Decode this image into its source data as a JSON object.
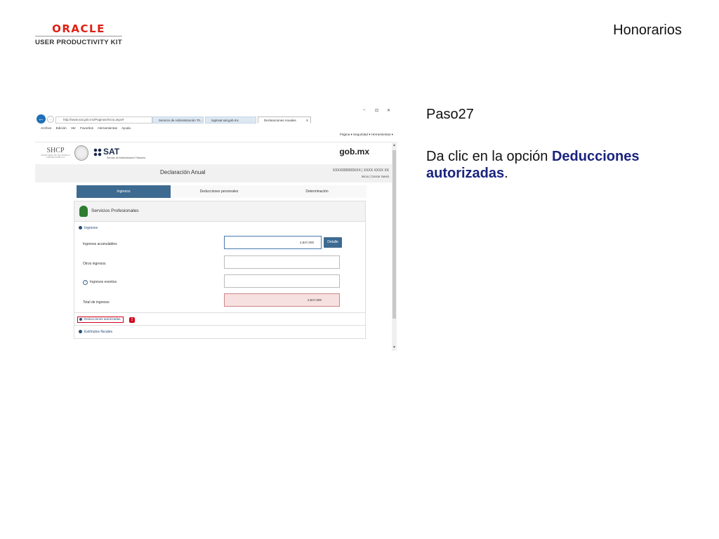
{
  "slide": {
    "logo_brand": "ORACLE",
    "logo_sub": "USER PRODUCTIVITY KIT",
    "title": "Honorarios",
    "step": "Paso27",
    "instruction_prefix": "Da clic en la opción ",
    "instruction_bold": "Deducciones autorizadas",
    "instruction_suffix": "."
  },
  "browser": {
    "address": "http://www.sat.gob.mx/Paginas/Inicio.aspx#",
    "tabs": [
      "Servicio de Administración Tri...",
      "loginsat.sat.gob.mx",
      "Declaraciones Anuales"
    ],
    "tab_close": "X",
    "window_controls": [
      "–",
      "⊡",
      "✕"
    ],
    "menu": [
      "Archivo",
      "Edición",
      "Ver",
      "Favoritos",
      "Herramientas",
      "Ayuda"
    ],
    "commandbar": "Página ▾   Seguridad ▾   Herramientas ▾"
  },
  "page": {
    "shcp": "SHCP",
    "shcp_sub": "SECRETARÍA DE HACIENDA Y CRÉDITO PÚBLICO",
    "sat": "SAT",
    "sat_sub": "Servicio de Administración Tributaria",
    "gob": "gob.mx",
    "decl_title": "Declaración Anual",
    "rfc": "XXXX000000XXX   | XXXX XXXX XX",
    "inicio": "Inicio | Cerrar Sesió",
    "tabs": [
      "Ingresos",
      "Deducciones personales",
      "Determinación"
    ],
    "panel_title": "Servicios Profesionales",
    "section_ingresos": "Ingresos",
    "rows": {
      "acumulables_label": "Ingresos acumulables",
      "acumulables_value": "2,847,000",
      "otros_label": "Otros ingresos",
      "exentos_label": "Ingresos exentos",
      "total_label": "Total de ingresos",
      "total_value": "2,847,000"
    },
    "detalle": "Detalle",
    "help": "?",
    "deducciones": "Deducciones autorizadas",
    "badge": "2",
    "estimulos": "Estímulos fiscales"
  }
}
